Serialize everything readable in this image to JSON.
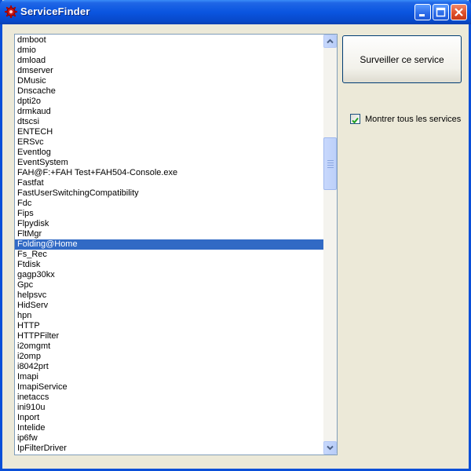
{
  "window": {
    "title": "ServiceFinder",
    "icon": "gear-icon"
  },
  "actions": {
    "monitor_button_label": "Surveiller ce service"
  },
  "options": {
    "show_all_label": "Montrer tous les services",
    "show_all_checked": true
  },
  "services": {
    "selected": "Folding@Home",
    "items": [
      "dmboot",
      "dmio",
      "dmload",
      "dmserver",
      "DMusic",
      "Dnscache",
      "dpti2o",
      "drmkaud",
      "dtscsi",
      "ENTECH",
      "ERSvc",
      "Eventlog",
      "EventSystem",
      "FAH@F:+FAH Test+FAH504-Console.exe",
      "Fastfat",
      "FastUserSwitchingCompatibility",
      "Fdc",
      "Fips",
      "Flpydisk",
      "FltMgr",
      "Folding@Home",
      "Fs_Rec",
      "Ftdisk",
      "gagp30kx",
      "Gpc",
      "helpsvc",
      "HidServ",
      "hpn",
      "HTTP",
      "HTTPFilter",
      "i2omgmt",
      "i2omp",
      "i8042prt",
      "Imapi",
      "ImapiService",
      "inetaccs",
      "ini910u",
      "Inport",
      "Intelide",
      "ip6fw",
      "IpFilterDriver"
    ]
  }
}
